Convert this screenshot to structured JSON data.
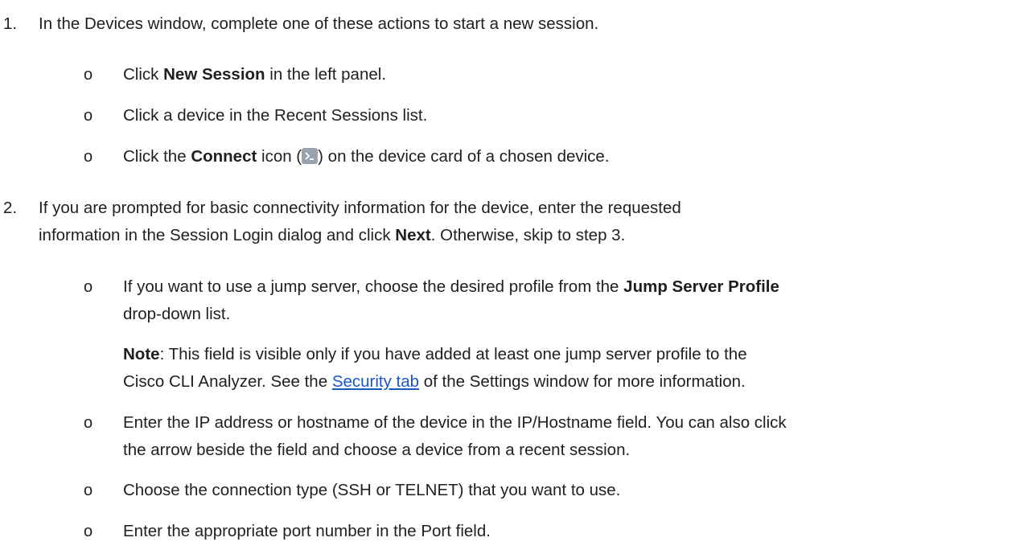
{
  "steps": [
    {
      "number": "1.",
      "text": "In the Devices window, complete one of these actions to start a new session.",
      "bullets": [
        {
          "pre": "Click ",
          "bold": "New Session",
          "post": " in the left panel."
        },
        {
          "text": "Click a device in the Recent Sessions list."
        },
        {
          "pre": "Click the ",
          "bold": "Connect",
          "mid": " icon (",
          "icon": "terminal-connect-icon",
          "post": ") on the device card of a chosen device."
        }
      ]
    },
    {
      "number": "2.",
      "line1": "If you are prompted for basic connectivity information for the device, enter the requested",
      "line2_pre": "information in the Session Login dialog and click ",
      "line2_bold": "Next",
      "line2_post": ". Otherwise, skip to step 3.",
      "bullets": [
        {
          "line1_pre": "If you want to use a jump server, choose the desired profile from the ",
          "line1_bold": "Jump Server Profile",
          "line2": "drop-down list."
        },
        {
          "note_label": "Note",
          "note_line1": ": This field is visible only if you have added at least one jump server profile to the",
          "note_line2_pre": "Cisco CLI Analyzer. See the ",
          "note_link": "Security tab",
          "note_line2_post": " of the Settings window for more information."
        },
        {
          "line1": "Enter the IP address or hostname of the device in the IP/Hostname field. You can also click",
          "line2": "the arrow beside the field and choose a device from a recent session."
        },
        {
          "text": "Choose the connection type (SSH or TELNET) that you want to use."
        },
        {
          "text": "Enter the appropriate port number in the Port field."
        }
      ]
    }
  ],
  "bullet_glyph": "o"
}
